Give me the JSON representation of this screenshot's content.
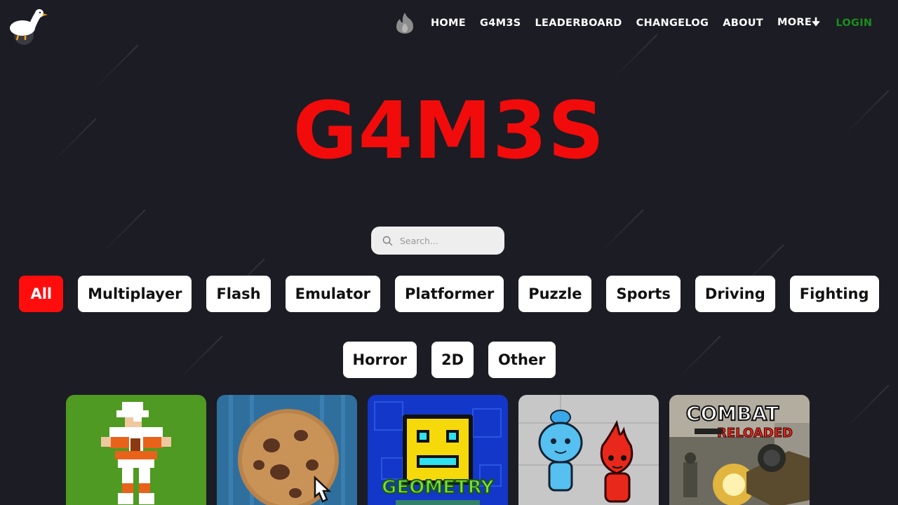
{
  "site": {
    "logo_icon": "goose-logo-icon",
    "title": "G4M3S",
    "title_color": "#f20b0b",
    "background": "#1c1c24"
  },
  "nav": {
    "flame_icon": "flame-icon",
    "items": [
      {
        "label": "HOME"
      },
      {
        "label": "G4M3S"
      },
      {
        "label": "LEADERBOARD"
      },
      {
        "label": "CHANGELOG"
      },
      {
        "label": "ABOUT"
      },
      {
        "label": "MORE🠋"
      }
    ],
    "login": {
      "label": "LOGIN",
      "color": "#1a8f1a"
    }
  },
  "search": {
    "placeholder": "Search...",
    "value": "",
    "icon": "search-icon"
  },
  "categories": {
    "row1": [
      {
        "label": "All",
        "active": true
      },
      {
        "label": "Multiplayer"
      },
      {
        "label": "Flash"
      },
      {
        "label": "Emulator"
      },
      {
        "label": "Platformer"
      },
      {
        "label": "Puzzle"
      },
      {
        "label": "Sports"
      },
      {
        "label": "Driving"
      },
      {
        "label": "Fighting"
      }
    ],
    "row2": [
      {
        "label": "Horror"
      },
      {
        "label": "2D"
      },
      {
        "label": "Other"
      }
    ],
    "active_color": "#ff0d0d"
  },
  "games": {
    "tiles": [
      {
        "icon": "pixel-football-player-thumbnail"
      },
      {
        "icon": "cookie-clicker-thumbnail"
      },
      {
        "icon": "geometry-dash-thumbnail",
        "text": "GEOMETRY"
      },
      {
        "icon": "fireboy-watergirl-thumbnail"
      },
      {
        "icon": "combat-reloaded-thumbnail",
        "text_line1": "COMBAT",
        "text_line2": "RELOADED"
      }
    ]
  }
}
